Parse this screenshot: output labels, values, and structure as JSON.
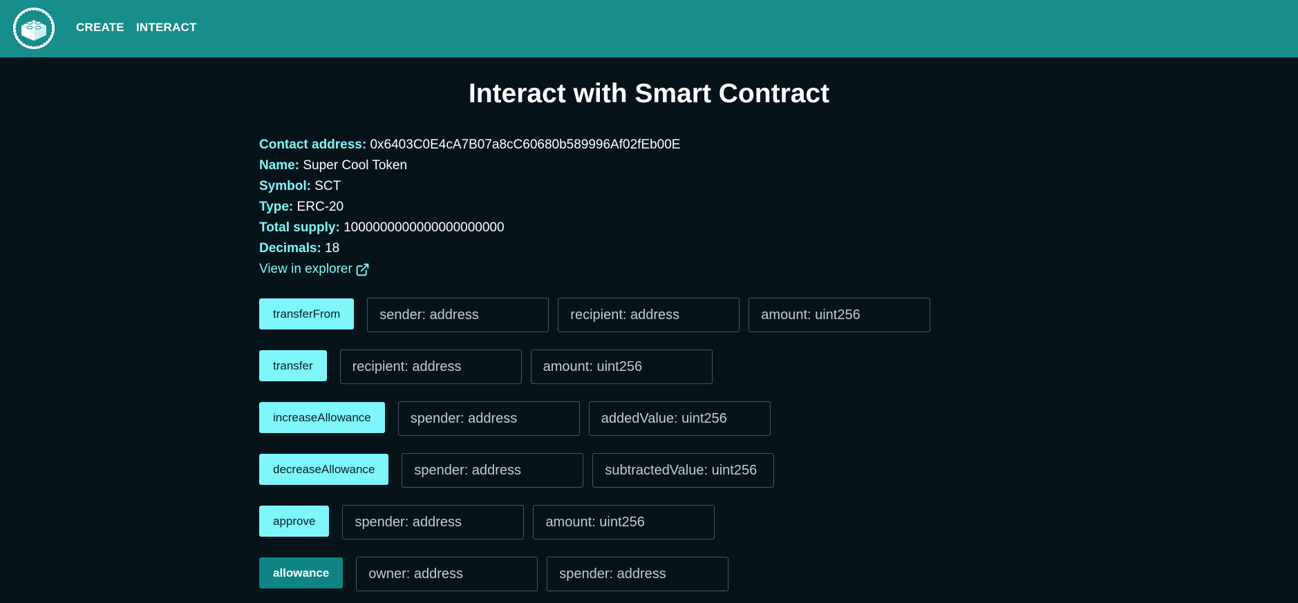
{
  "nav": {
    "create": "CREATE",
    "interact": "INTERACT"
  },
  "page": {
    "title": "Interact with Smart Contract"
  },
  "contract": {
    "address_label": "Contact address:",
    "address_value": "0x6403C0E4cA7B07a8cC60680b589996Af02fEb00E",
    "name_label": "Name:",
    "name_value": "Super Cool Token",
    "symbol_label": "Symbol:",
    "symbol_value": "SCT",
    "type_label": "Type:",
    "type_value": "ERC-20",
    "supply_label": "Total supply:",
    "supply_value": "1000000000000000000000",
    "decimals_label": "Decimals:",
    "decimals_value": "18",
    "explorer_link": "View in explorer"
  },
  "functions": [
    {
      "label": "transferFrom",
      "inputs": [
        "sender: address",
        "recipient: address",
        "amount: uint256"
      ]
    },
    {
      "label": "transfer",
      "inputs": [
        "recipient: address",
        "amount: uint256"
      ]
    },
    {
      "label": "increaseAllowance",
      "inputs": [
        "spender: address",
        "addedValue: uint256"
      ]
    },
    {
      "label": "decreaseAllowance",
      "inputs": [
        "spender: address",
        "subtractedValue: uint256"
      ]
    },
    {
      "label": "approve",
      "inputs": [
        "spender: address",
        "amount: uint256"
      ]
    },
    {
      "label": "allowance",
      "inputs": [
        "owner: address",
        "spender: address"
      ]
    }
  ],
  "colors": {
    "topbar": "#178e8c",
    "background": "#061419",
    "accent": "#7ef6fb",
    "read_button": "#0e8584"
  },
  "icons": {
    "logo": "lego-brick-logo",
    "external_link": "external-link-icon"
  }
}
